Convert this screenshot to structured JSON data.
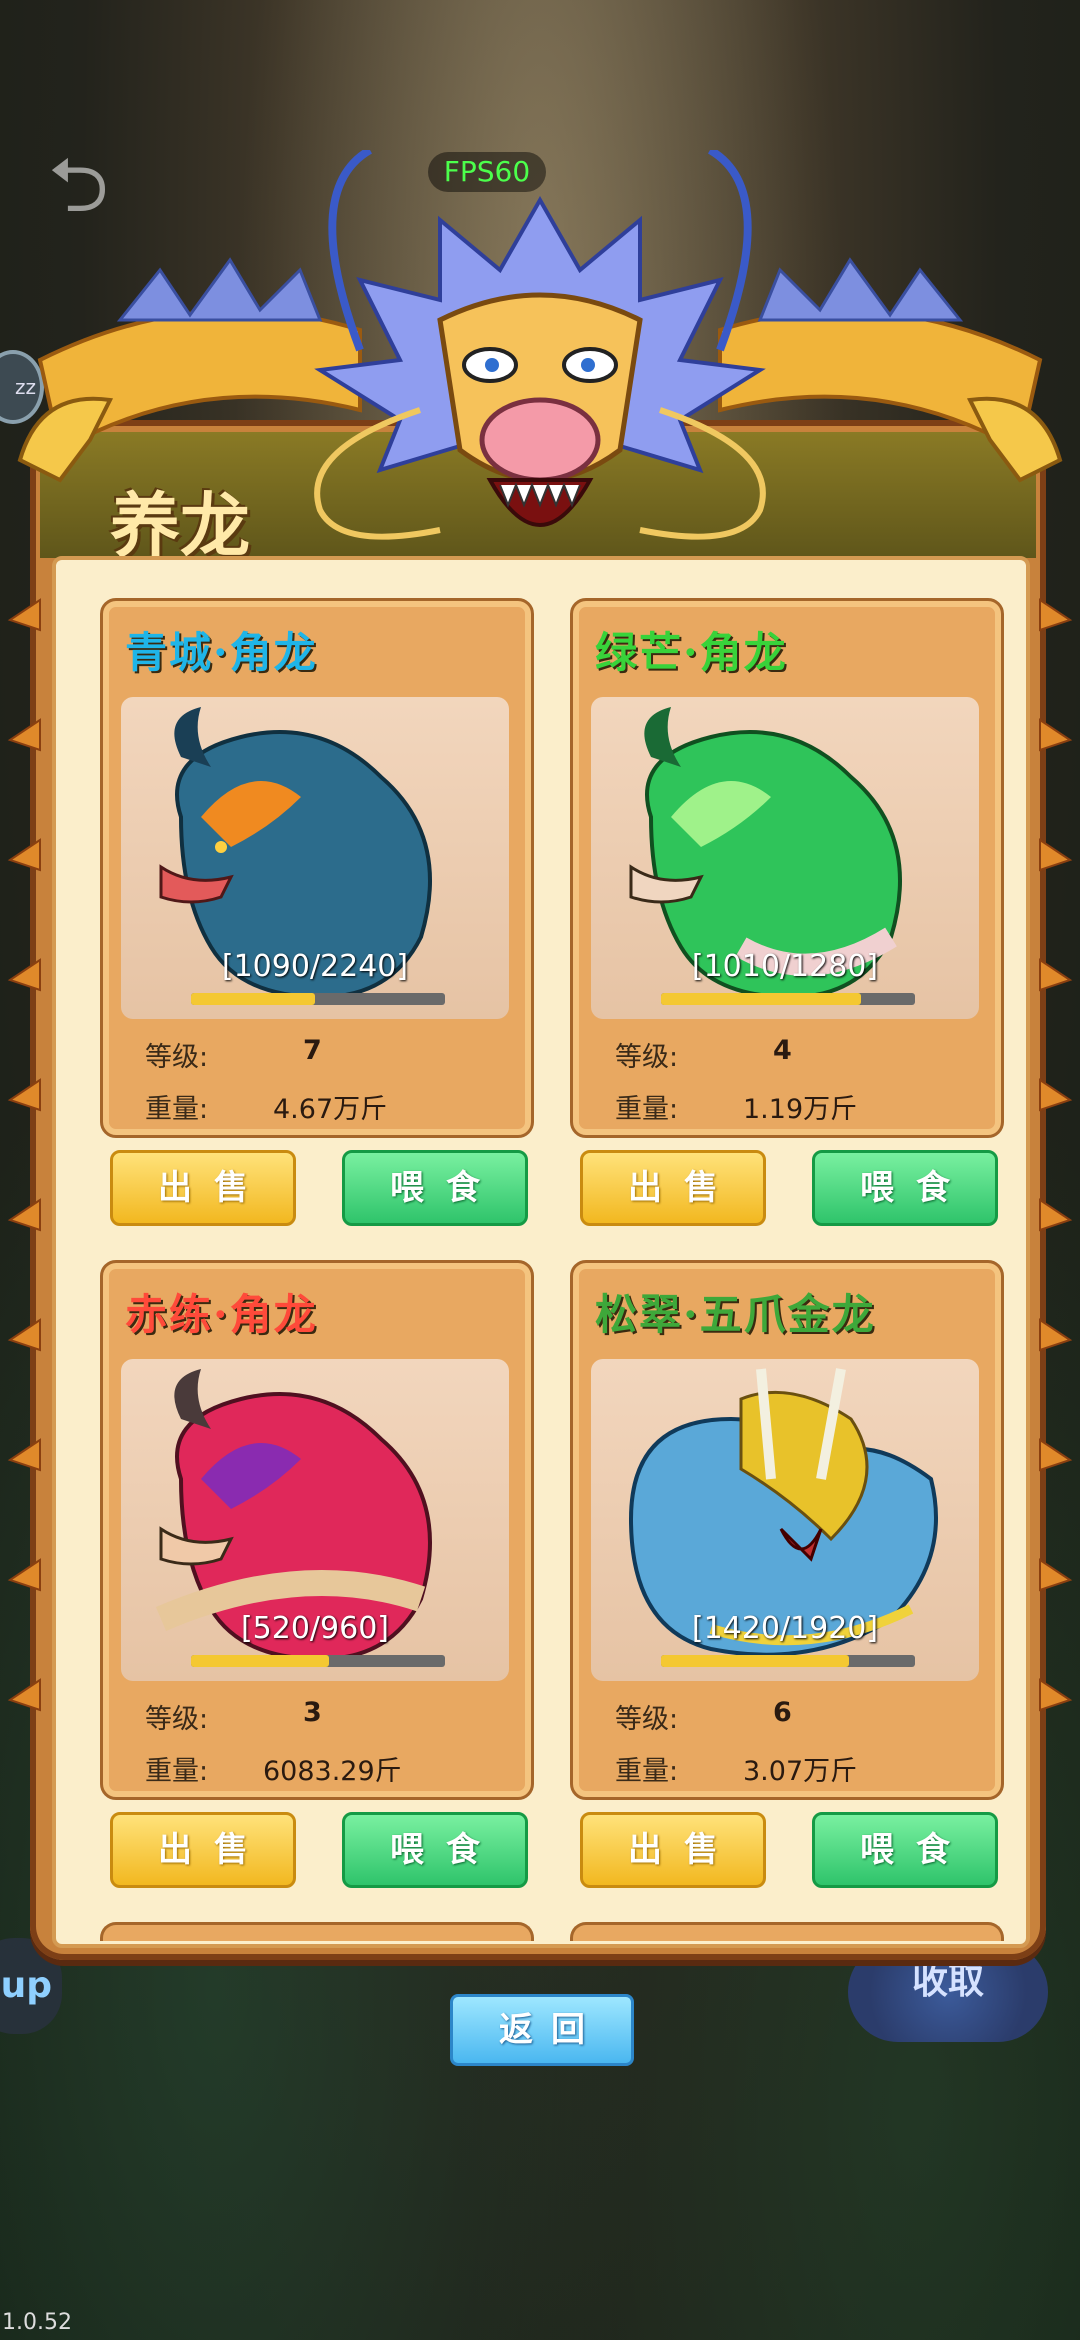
{
  "hud": {
    "fps": "FPS60",
    "version": "1.0.52",
    "left_badge": "zz",
    "left_button": "up",
    "right_button": "收取"
  },
  "panel": {
    "title": "养龙"
  },
  "labels": {
    "level": "等级:",
    "weight": "重量:",
    "sell": "出售",
    "feed": "喂食",
    "back": "返回"
  },
  "colors": {
    "sell_button": "#f2b820",
    "feed_button": "#2fc46b",
    "back_button": "#4ab7f0",
    "xp_fill": "#f4c832"
  },
  "dragons": [
    {
      "name": "青城·角龙",
      "name_color": "#1fb5e8",
      "xp": "[1090/2240]",
      "xp_fraction": 0.487,
      "level": "7",
      "weight": "4.67万斤",
      "body_color": "#2c6c8c",
      "accent_color": "#f08a20"
    },
    {
      "name": "绿芒·角龙",
      "name_color": "#38d33a",
      "xp": "[1010/1280]",
      "xp_fraction": 0.789,
      "level": "4",
      "weight": "1.19万斤",
      "body_color": "#2fc45a",
      "accent_color": "#9ff28a"
    },
    {
      "name": "赤练·角龙",
      "name_color": "#ff4a3a",
      "xp": "[520/960]",
      "xp_fraction": 0.542,
      "level": "3",
      "weight": "6083.29斤",
      "body_color": "#e0285a",
      "accent_color": "#8a2bb0"
    },
    {
      "name": "松翠·五爪金龙",
      "name_color": "#3ea83a",
      "xp": "[1420/1920]",
      "xp_fraction": 0.74,
      "level": "6",
      "weight": "3.07万斤",
      "body_color": "#5aa8d8",
      "accent_color": "#e8c22a"
    }
  ]
}
